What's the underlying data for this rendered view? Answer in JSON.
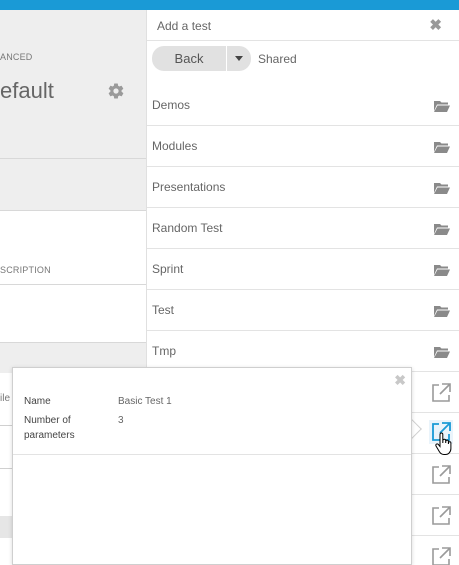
{
  "background": {
    "section_label_advanced": "ANCED",
    "title": "efault",
    "section_label_description": "SCRIPTION",
    "file_label": "ile"
  },
  "panel": {
    "title": "Add a test",
    "close_icon": "close-icon",
    "back_label": "Back",
    "breadcrumb": "Shared",
    "folders": [
      {
        "label": "Demos",
        "icon": "folder-icon"
      },
      {
        "label": "Modules",
        "icon": "folder-icon"
      },
      {
        "label": "Presentations",
        "icon": "folder-icon"
      },
      {
        "label": "Random Test",
        "icon": "folder-icon"
      },
      {
        "label": "Sprint",
        "icon": "folder-icon"
      },
      {
        "label": "Test",
        "icon": "folder-icon"
      },
      {
        "label": "Tmp",
        "icon": "folder-icon"
      }
    ]
  },
  "popover": {
    "name_label": "Name",
    "name_value": "Basic Test 1",
    "params_label": "Number of parameters",
    "params_value": "3"
  },
  "colors": {
    "accent": "#1a9ad6",
    "icon": "#8a8a8a"
  }
}
